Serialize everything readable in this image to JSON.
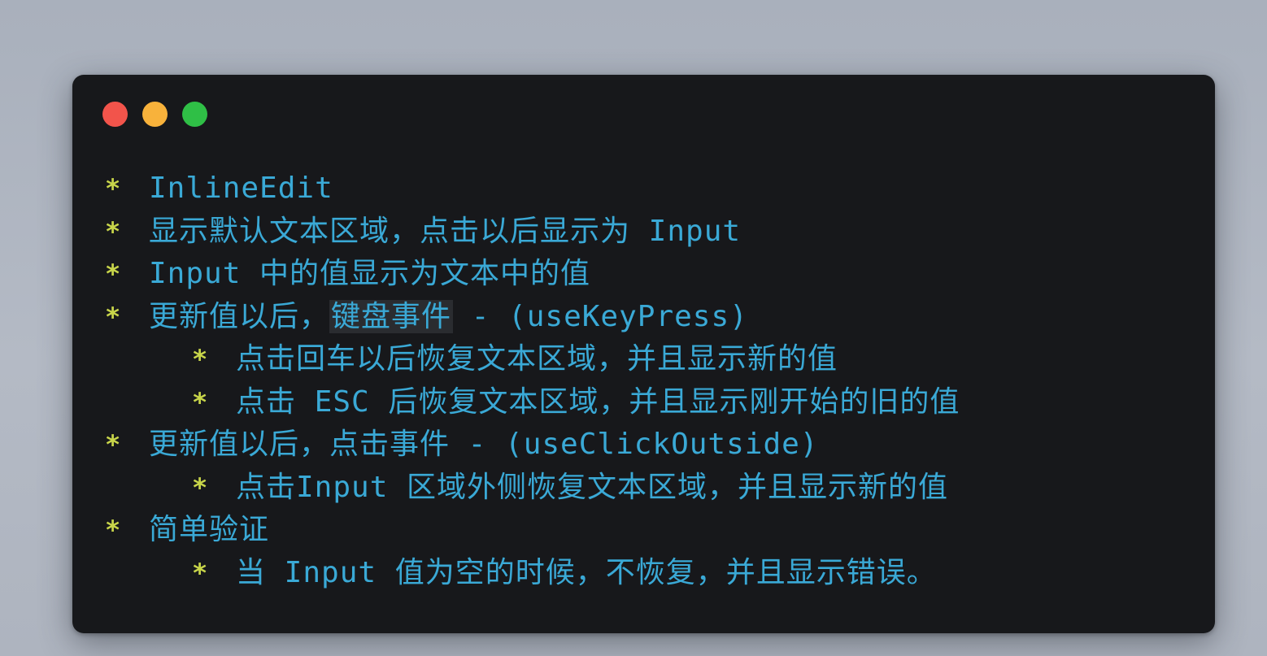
{
  "window": {
    "colors": {
      "background": "#17181b",
      "text": "#3aa9d6",
      "bullet": "#c8d54a",
      "close": "#f2544b",
      "minimize": "#f8b23b",
      "maximize": "#2fbf46"
    }
  },
  "notes": {
    "bullet": "*",
    "lines": [
      {
        "level": 1,
        "text": "InlineEdit"
      },
      {
        "level": 1,
        "text": "显示默认文本区域，点击以后显示为 Input"
      },
      {
        "level": 1,
        "text": "Input 中的值显示为文本中的值"
      },
      {
        "level": 1,
        "text_before": "更新值以后，",
        "highlight": "键盘事件",
        "text_after": " -  (useKeyPress)"
      },
      {
        "level": 2,
        "text": "点击回车以后恢复文本区域，并且显示新的值"
      },
      {
        "level": 2,
        "text": "点击 ESC 后恢复文本区域，并且显示刚开始的旧的值"
      },
      {
        "level": 1,
        "text": "更新值以后，点击事件 - (useClickOutside)"
      },
      {
        "level": 2,
        "text": "点击Input 区域外侧恢复文本区域，并且显示新的值"
      },
      {
        "level": 1,
        "text": "简单验证"
      },
      {
        "level": 2,
        "text": "当 Input 值为空的时候，不恢复，并且显示错误。"
      }
    ]
  }
}
